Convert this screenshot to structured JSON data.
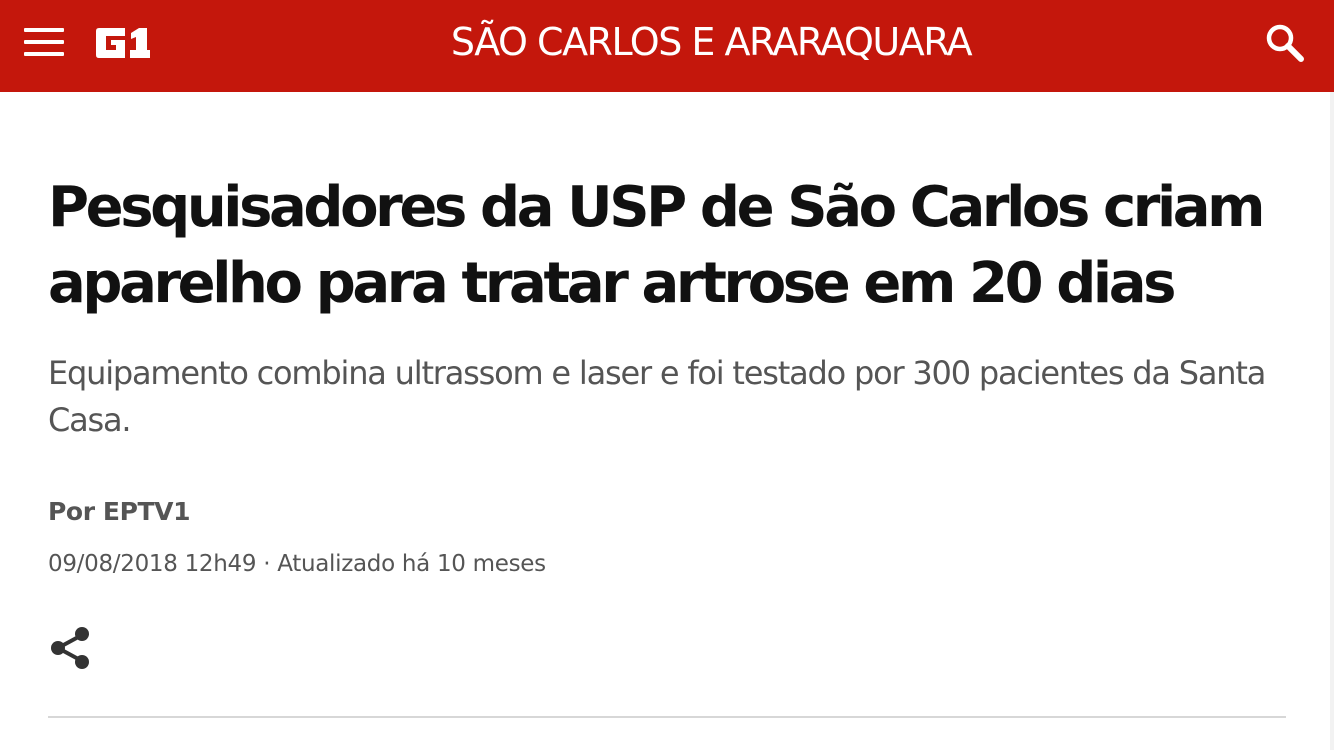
{
  "header": {
    "menu_icon": "hamburger-menu-icon",
    "logo_text": "G1",
    "section_title": "SÃO CARLOS E ARARAQUARA",
    "search_icon": "search-icon",
    "background_color": "#c4170c"
  },
  "article": {
    "headline": "Pesquisadores da USP de São Carlos criam aparelho para tratar artrose em 20 dias",
    "subtitle": "Equipamento combina ultrassom e laser e foi testado por 300 pacientes da Santa Casa.",
    "author": "Por EPTV1",
    "published": "09/08/2018 12h49",
    "separator": "·",
    "updated": "Atualizado há 10 meses",
    "share_icon": "share-icon"
  },
  "colors": {
    "brand_red": "#c4170c",
    "headline_text": "#111111",
    "secondary_text": "#555555",
    "divider": "#d7d7d7"
  }
}
